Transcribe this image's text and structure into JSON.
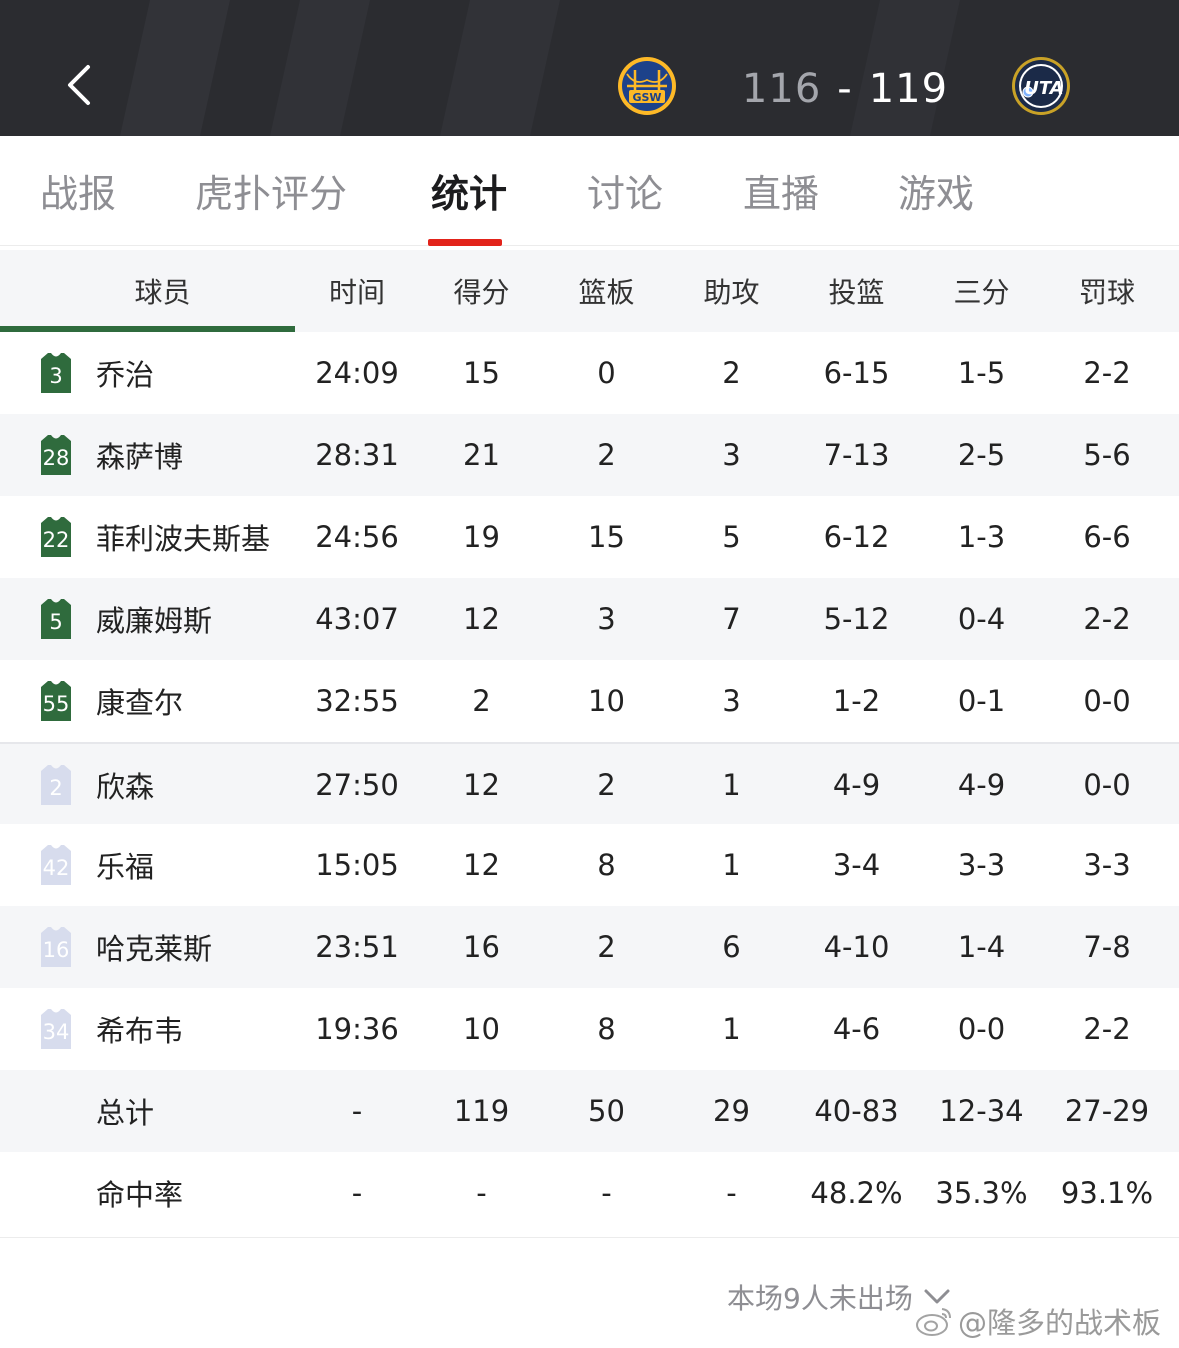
{
  "header": {
    "home_score": "116",
    "separator": "-",
    "away_score": "119",
    "home_logo_text": "GSW",
    "away_logo_text": "UTA",
    "colors": {
      "background": "#2b2c30",
      "gsw_blue": "#1d428a",
      "gsw_gold": "#fdb927",
      "uta_navy": "#1b2a48"
    }
  },
  "tabs": [
    {
      "label": "战报"
    },
    {
      "label": "虎扑评分"
    },
    {
      "label": "统计"
    },
    {
      "label": "讨论"
    },
    {
      "label": "直播"
    },
    {
      "label": "游戏"
    }
  ],
  "active_tab": "统计",
  "table": {
    "columns": [
      "球员",
      "时间",
      "得分",
      "篮板",
      "助攻",
      "投篮",
      "三分",
      "罚球"
    ],
    "starters": [
      {
        "number": "3",
        "name": "乔治",
        "min": "24:09",
        "pts": "15",
        "reb": "0",
        "ast": "2",
        "fg": "6-15",
        "tp": "1-5",
        "ft": "2-2"
      },
      {
        "number": "28",
        "name": "森萨博",
        "min": "28:31",
        "pts": "21",
        "reb": "2",
        "ast": "3",
        "fg": "7-13",
        "tp": "2-5",
        "ft": "5-6"
      },
      {
        "number": "22",
        "name": "菲利波夫斯基",
        "min": "24:56",
        "pts": "19",
        "reb": "15",
        "ast": "5",
        "fg": "6-12",
        "tp": "1-3",
        "ft": "6-6"
      },
      {
        "number": "5",
        "name": "威廉姆斯",
        "min": "43:07",
        "pts": "12",
        "reb": "3",
        "ast": "7",
        "fg": "5-12",
        "tp": "0-4",
        "ft": "2-2"
      },
      {
        "number": "55",
        "name": "康查尔",
        "min": "32:55",
        "pts": "2",
        "reb": "10",
        "ast": "3",
        "fg": "1-2",
        "tp": "0-1",
        "ft": "0-0"
      }
    ],
    "bench": [
      {
        "number": "2",
        "name": "欣森",
        "min": "27:50",
        "pts": "12",
        "reb": "2",
        "ast": "1",
        "fg": "4-9",
        "tp": "4-9",
        "ft": "0-0"
      },
      {
        "number": "42",
        "name": "乐福",
        "min": "15:05",
        "pts": "12",
        "reb": "8",
        "ast": "1",
        "fg": "3-4",
        "tp": "3-3",
        "ft": "3-3"
      },
      {
        "number": "16",
        "name": "哈克莱斯",
        "min": "23:51",
        "pts": "16",
        "reb": "2",
        "ast": "6",
        "fg": "4-10",
        "tp": "1-4",
        "ft": "7-8"
      },
      {
        "number": "34",
        "name": "希布韦",
        "min": "19:36",
        "pts": "10",
        "reb": "8",
        "ast": "1",
        "fg": "4-6",
        "tp": "0-0",
        "ft": "2-2"
      }
    ],
    "totals": {
      "label": "总计",
      "min": "-",
      "pts": "119",
      "reb": "50",
      "ast": "29",
      "fg": "40-83",
      "tp": "12-34",
      "ft": "27-29"
    },
    "pct": {
      "label": "命中率",
      "min": "-",
      "pts": "-",
      "reb": "-",
      "ast": "-",
      "fg": "48.2%",
      "tp": "35.3%",
      "ft": "93.1%"
    },
    "colors": {
      "starter_jersey": "#2f6b3d",
      "bench_jersey": "#d7dced",
      "accent": "#e2231a"
    }
  },
  "footer": {
    "dnp_text": "本场9人未出场",
    "watermark": "@隆多的战术板"
  }
}
